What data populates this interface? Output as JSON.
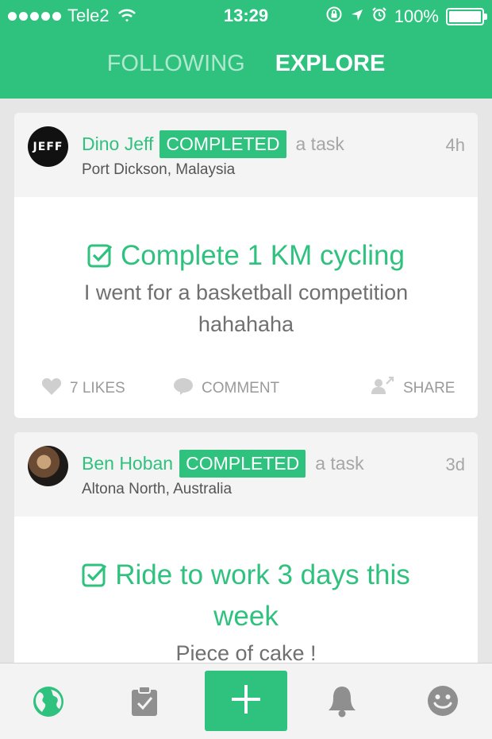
{
  "status_bar": {
    "carrier": "Tele2",
    "time": "13:29",
    "battery": "100%"
  },
  "tabs": [
    {
      "label": "FOLLOWING",
      "active": false
    },
    {
      "label": "EXPLORE",
      "active": true
    }
  ],
  "posts": [
    {
      "avatar_text": "JEFF",
      "user": "Dino Jeff",
      "badge": "COMPLETED",
      "action_text": "a task",
      "time": "4h",
      "location": "Port Dickson, Malaysia",
      "task_title": "Complete 1 KM cycling",
      "description": "I went for a basketball competition hahahaha",
      "likes_label": "7 LIKES",
      "comment_label": "COMMENT",
      "share_label": "SHARE"
    },
    {
      "user": "Ben Hoban",
      "badge": "COMPLETED",
      "action_text": "a task",
      "time": "3d",
      "location": "Altona North, Australia",
      "task_title": "Ride to work 3 days this week",
      "description": "Piece of cake !"
    }
  ],
  "bottom_nav": [
    "globe-icon",
    "clipboard-icon",
    "plus-icon",
    "bell-icon",
    "smiley-icon"
  ],
  "colors": {
    "accent": "#2ec27e",
    "header_bg": "#2ec27e",
    "card_head_bg": "#f4f4f4",
    "muted_text": "#a6a6a6"
  }
}
